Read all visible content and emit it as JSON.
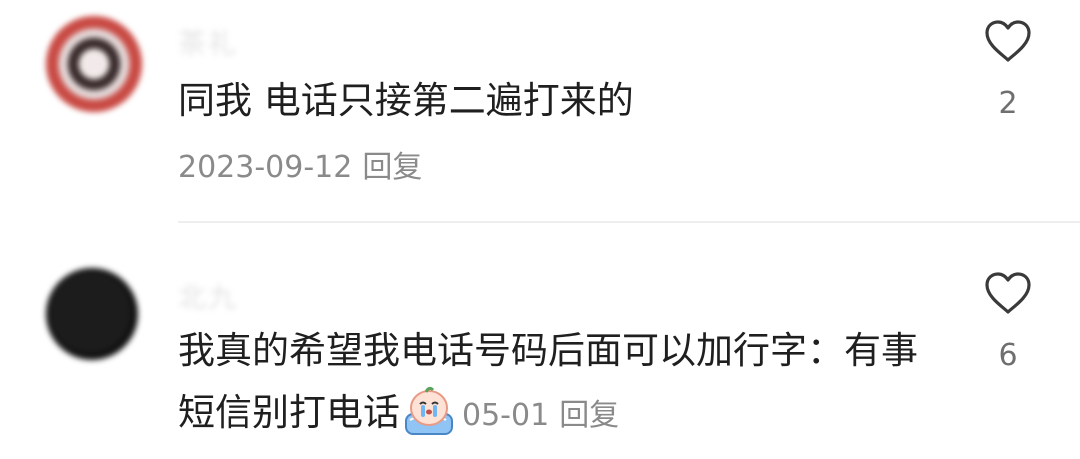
{
  "comments": [
    {
      "username": "茶礼",
      "text": "同我 电话只接第二遍打来的",
      "date": "2023-09-12",
      "reply_label": "回复",
      "like_count": "2"
    },
    {
      "username": "北九",
      "text": "我真的希望我电话号码后面可以加行字：有事短信别打电话",
      "date": "05-01",
      "reply_label": "回复",
      "like_count": "6"
    }
  ],
  "icons": {
    "like": "heart-outline-icon",
    "emoji": "crying-face-emoji"
  },
  "colors": {
    "text_primary": "#1f1f1f",
    "text_secondary": "#8a8a8a",
    "divider": "#eeeeee"
  }
}
